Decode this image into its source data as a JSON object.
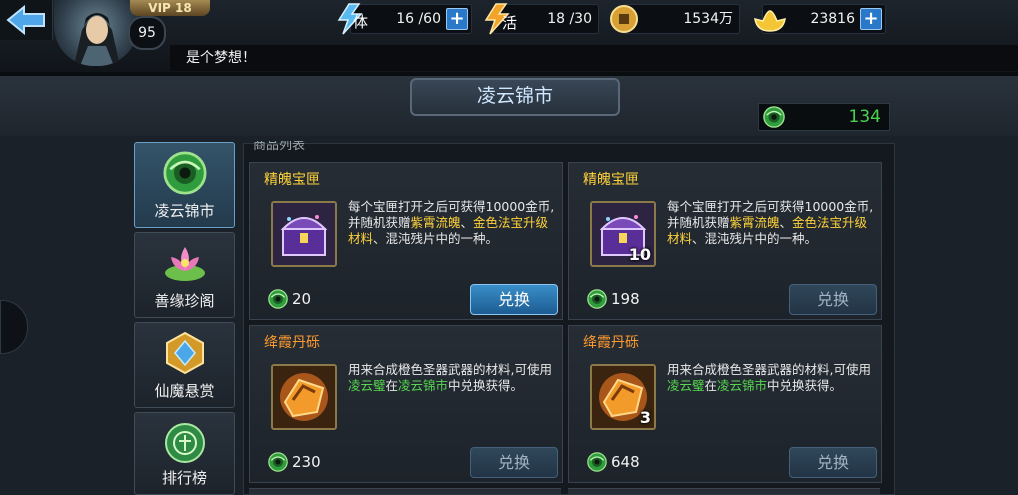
{
  "player": {
    "vip_label": "VIP 18",
    "level": "95",
    "message": "是个梦想！"
  },
  "resources": {
    "stamina": {
      "icon": "stamina-lightning-icon",
      "label": "体",
      "value": "16 /60"
    },
    "vitality": {
      "icon": "vitality-lightning-icon",
      "label": "活",
      "value": "18 /30"
    },
    "coins": {
      "icon": "copper-coin-icon",
      "value": "1534万"
    },
    "gold": {
      "icon": "gold-ingot-icon",
      "value": "23816"
    },
    "plus_label": "+"
  },
  "shop": {
    "title": "凌云锦市",
    "currency_icon": "jade-coin-icon",
    "currency_value": "134",
    "list_header": "商品列表"
  },
  "nav": [
    {
      "label": "凌云锦市",
      "icon": "jade-coin-icon",
      "active": true
    },
    {
      "label": "善缘珍阁",
      "icon": "lotus-icon",
      "active": false
    },
    {
      "label": "仙魔悬赏",
      "icon": "gem-shield-icon",
      "active": false
    },
    {
      "label": "排行榜",
      "icon": "ranking-medal-icon",
      "active": false
    }
  ],
  "items": [
    {
      "name": "精魄宝匣",
      "name_color": "#ffd23a",
      "icon": "treasure-chest-icon",
      "quantity": "",
      "desc_parts": [
        {
          "text": "每个宝匣打开之后可获得10000金币,并随机获赠",
          "color": "white"
        },
        {
          "text": "紫霄流魄",
          "color": "yellow"
        },
        {
          "text": "、",
          "color": "white"
        },
        {
          "text": "金色法宝升级材料",
          "color": "yellow"
        },
        {
          "text": "、混沌残片中的一种。",
          "color": "white"
        }
      ],
      "cost": "20",
      "button": "兑换",
      "button_enabled": true
    },
    {
      "name": "精魄宝匣",
      "name_color": "#ffd23a",
      "icon": "treasure-chest-icon",
      "quantity": "10",
      "desc_parts": [
        {
          "text": "每个宝匣打开之后可获得10000金币,并随机获赠",
          "color": "white"
        },
        {
          "text": "紫霄流魄",
          "color": "yellow"
        },
        {
          "text": "、",
          "color": "white"
        },
        {
          "text": "金色法宝升级材料",
          "color": "yellow"
        },
        {
          "text": "、混沌残片中的一种。",
          "color": "white"
        }
      ],
      "cost": "198",
      "button": "兑换",
      "button_enabled": false
    },
    {
      "name": "绛霞丹砾",
      "name_color": "#ff9a2e",
      "icon": "orange-ore-icon",
      "quantity": "",
      "desc_parts": [
        {
          "text": "用来合成橙色圣器武器的材料,可使用",
          "color": "white"
        },
        {
          "text": "凌云璧",
          "color": "green"
        },
        {
          "text": "在",
          "color": "white"
        },
        {
          "text": "凌云锦市",
          "color": "green"
        },
        {
          "text": "中兑换获得。",
          "color": "white"
        }
      ],
      "cost": "230",
      "button": "兑换",
      "button_enabled": false
    },
    {
      "name": "绛霞丹砾",
      "name_color": "#ff9a2e",
      "icon": "orange-ore-icon",
      "quantity": "3",
      "desc_parts": [
        {
          "text": "用来合成橙色圣器武器的材料,可使用",
          "color": "white"
        },
        {
          "text": "凌云璧",
          "color": "green"
        },
        {
          "text": "在",
          "color": "white"
        },
        {
          "text": "凌云锦市",
          "color": "green"
        },
        {
          "text": "中兑换获得。",
          "color": "white"
        }
      ],
      "cost": "648",
      "button": "兑换",
      "button_enabled": false
    }
  ]
}
